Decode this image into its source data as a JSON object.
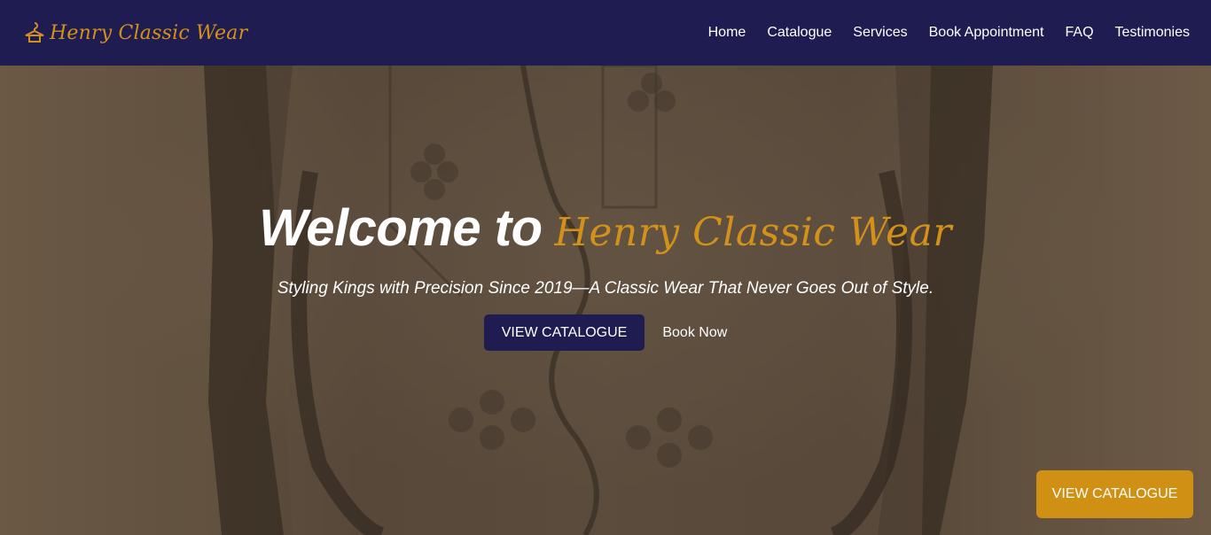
{
  "brand": {
    "icon": "hanger-icon",
    "name": "Henry Classic Wear"
  },
  "nav": [
    {
      "label": "Home"
    },
    {
      "label": "Catalogue"
    },
    {
      "label": "Services"
    },
    {
      "label": "Book Appointment"
    },
    {
      "label": "FAQ"
    },
    {
      "label": "Testimonies"
    }
  ],
  "hero": {
    "title_prefix": "Welcome to",
    "title_brand": "Henry Classic Wear",
    "subtitle": "Styling Kings with Precision Since 2019—A Classic Wear That Never Goes Out of Style.",
    "primary_button": "VIEW CATALOGUE",
    "secondary_button": "Book Now"
  },
  "floating_button": {
    "label": "VIEW CATALOGUE"
  },
  "colors": {
    "navy": "#1f1c52",
    "gold": "#d4911a",
    "floating_gold": "#cf9014",
    "white": "#ffffff"
  }
}
